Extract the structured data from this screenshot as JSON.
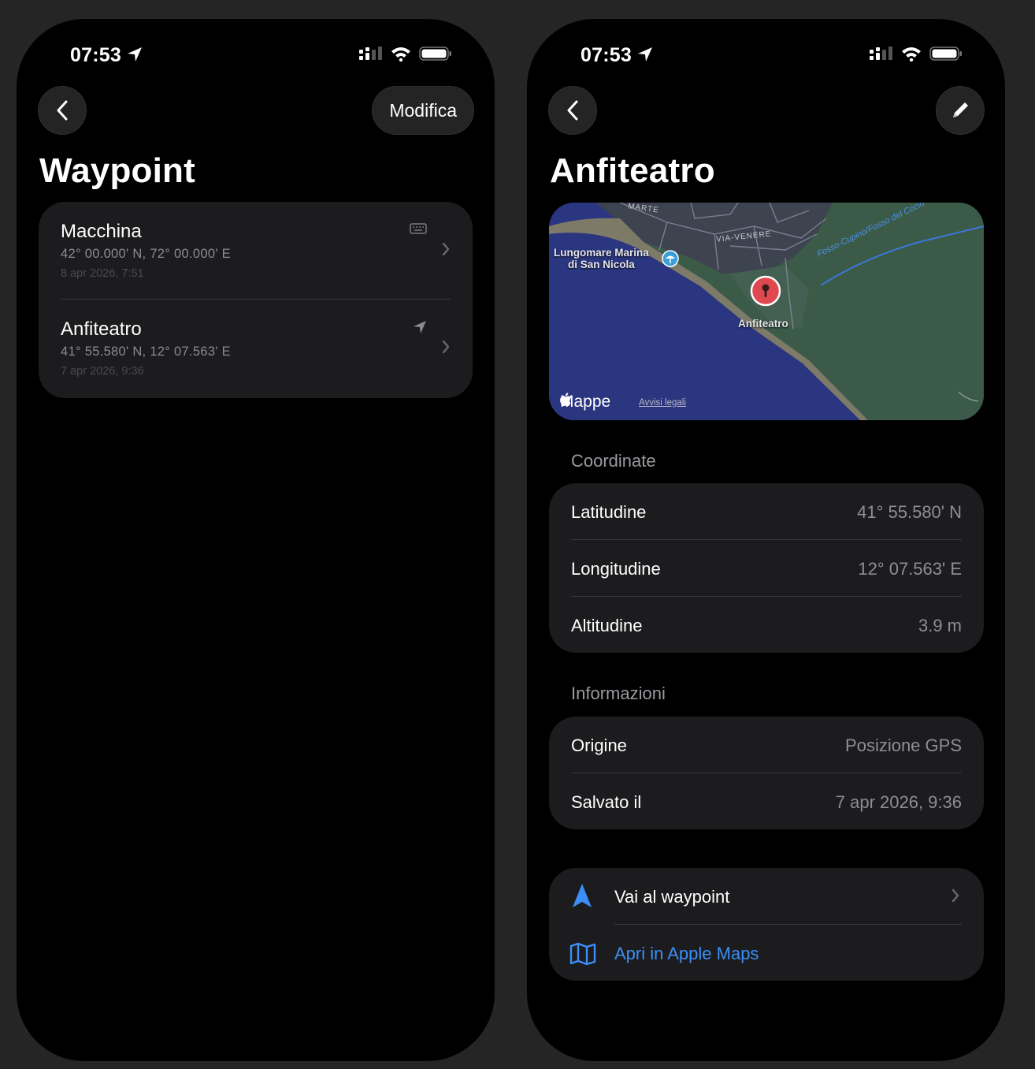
{
  "status_bar": {
    "time": "07:53"
  },
  "list_screen": {
    "edit_button": "Modifica",
    "title": "Waypoint",
    "waypoints": [
      {
        "name": "Macchina",
        "coords": "42° 00.000' N,  72° 00.000' E",
        "date": "8 apr 2026, 7:51",
        "source_icon": "keyboard-icon"
      },
      {
        "name": "Anfiteatro",
        "coords": "41° 55.580' N,  12° 07.563' E",
        "date": "7 apr 2026, 9:36",
        "source_icon": "location-arrow-icon"
      }
    ]
  },
  "detail_screen": {
    "title": "Anfiteatro",
    "map": {
      "label_place": "Lungomare Marina\ndi San Nicola",
      "label_pin": "Anfiteatro",
      "label_road": "VIA-VENERE",
      "label_road_top": "MARTE",
      "label_canal": "Fosso-Cupino/Fosso del Cocio",
      "brand": "Mappe",
      "legal": "Avvisi legali"
    },
    "coordinates_header": "Coordinate",
    "coordinates": [
      {
        "label": "Latitudine",
        "value": "41° 55.580' N"
      },
      {
        "label": "Longitudine",
        "value": "12° 07.563' E"
      },
      {
        "label": "Altitudine",
        "value": "3.9 m"
      }
    ],
    "info_header": "Informazioni",
    "info": [
      {
        "label": "Origine",
        "value": "Posizione GPS"
      },
      {
        "label": "Salvato il",
        "value": "7 apr 2026, 9:36"
      }
    ],
    "actions": [
      {
        "label": "Vai al waypoint",
        "icon": "navigation-arrow-icon"
      },
      {
        "label": "Apri in Apple Maps",
        "icon": "map-icon"
      }
    ]
  },
  "colors": {
    "accent_blue": "#3b8ff6",
    "card": "#1c1c1e",
    "pin_red": "#e0484f"
  }
}
